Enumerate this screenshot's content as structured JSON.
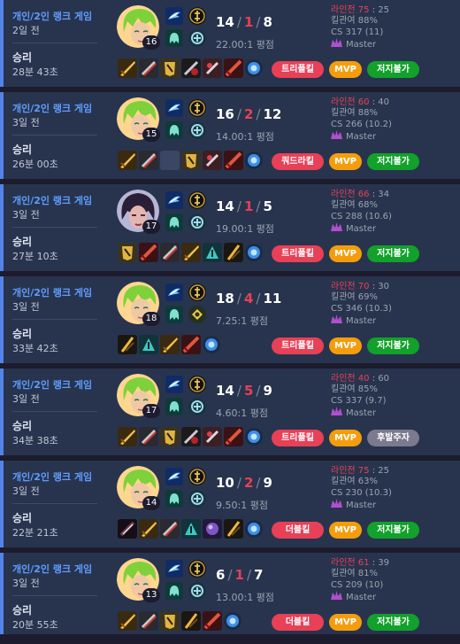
{
  "games": [
    {
      "queue": "개인/2인 랭크 게임",
      "ago": "2일 전",
      "result": "승리",
      "duration": "28분 43초",
      "champion": "green-haired-champion",
      "level": "16",
      "kills": "14",
      "deaths": "1",
      "assists": "8",
      "kda_ratio": "22.00:1 평점",
      "lane_label": "라인전",
      "lane_win": "75",
      "lane_lose": "25",
      "kill_participation": "킬관여 88%",
      "cs": "CS 317 (11)",
      "tier": "Master",
      "badges": [
        "트리플킬",
        "MVP",
        "저지불가"
      ],
      "items": [
        "gold-blade-icon",
        "striped-blade-icon",
        "gold-armor-icon",
        "red-dark-blade-icon",
        "ruby-sword-icon",
        "crimson-blade-icon",
        "blue-ward-icon"
      ]
    },
    {
      "queue": "개인/2인 랭크 게임",
      "ago": "3일 전",
      "result": "승리",
      "duration": "26분 00초",
      "champion": "green-haired-champion",
      "level": "15",
      "kills": "16",
      "deaths": "2",
      "assists": "12",
      "kda_ratio": "14.00:1 평점",
      "lane_label": "라인전",
      "lane_win": "60",
      "lane_lose": "40",
      "kill_participation": "킬관여 88%",
      "cs": "CS 266 (10.2)",
      "tier": "Master",
      "badges": [
        "쿼드라킬",
        "MVP",
        "저지불가"
      ],
      "items": [
        "gold-blade-icon",
        "striped-blade-icon",
        "empty-slot",
        "gold-armor-icon",
        "ruby-sword-icon",
        "crimson-blade-icon",
        "blue-ward-icon"
      ]
    },
    {
      "queue": "개인/2인 랭크 게임",
      "ago": "3일 전",
      "result": "승리",
      "duration": "27분 10초",
      "champion": "dark-haired-champion",
      "level": "17",
      "kills": "14",
      "deaths": "1",
      "assists": "5",
      "kda_ratio": "19.00:1 평점",
      "lane_label": "라인전",
      "lane_win": "66",
      "lane_lose": "34",
      "kill_participation": "킬관여 68%",
      "cs": "CS 288 (10.6)",
      "tier": "Master",
      "badges": [
        "트리플킬",
        "MVP",
        "저지불가"
      ],
      "items": [
        "gold-armor-icon",
        "crimson-blade-icon",
        "striped-blade-icon",
        "gold-blade-icon",
        "teal-blade-icon",
        "gold-dark-blade-icon",
        "blue-ward-icon"
      ]
    },
    {
      "queue": "개인/2인 랭크 게임",
      "ago": "3일 전",
      "result": "승리",
      "duration": "33분 42초",
      "champion": "green-haired-champion",
      "level": "18",
      "kills": "18",
      "deaths": "4",
      "assists": "11",
      "kda_ratio": "7.25:1 평점",
      "lane_label": "라인전",
      "lane_win": "70",
      "lane_lose": "30",
      "kill_participation": "킬관여 69%",
      "cs": "CS 346 (10.3)",
      "tier": "Master",
      "badges": [
        "트리플킬",
        "MVP",
        "저지불가"
      ],
      "items": [
        "gold-dark-blade-icon",
        "teal-blade-icon",
        "gold-blade-icon",
        "crimson-blade-icon",
        "blue-ward-icon"
      ]
    },
    {
      "queue": "개인/2인 랭크 게임",
      "ago": "3일 전",
      "result": "승리",
      "duration": "34분 38초",
      "champion": "green-haired-champion",
      "level": "17",
      "kills": "14",
      "deaths": "5",
      "assists": "9",
      "kda_ratio": "4.60:1 평점",
      "lane_label": "라인전",
      "lane_win": "40",
      "lane_lose": "60",
      "kill_participation": "킬관여 85%",
      "cs": "CS 337 (9.7)",
      "tier": "Master",
      "badges": [
        "트리플킬",
        "MVP",
        "후발주자"
      ],
      "items": [
        "gold-blade-icon",
        "striped-blade-icon",
        "gold-armor-icon",
        "red-dark-blade-icon",
        "ruby-sword-icon",
        "crimson-blade-icon",
        "blue-ward-icon"
      ]
    },
    {
      "queue": "개인/2인 랭크 게임",
      "ago": "3일 전",
      "result": "승리",
      "duration": "22분 21초",
      "champion": "green-haired-champion",
      "level": "14",
      "kills": "10",
      "deaths": "2",
      "assists": "9",
      "kda_ratio": "9.50:1 평점",
      "lane_label": "라인전",
      "lane_win": "75",
      "lane_lose": "25",
      "kill_participation": "킬관여 63%",
      "cs": "CS 230 (10.3)",
      "tier": "Master",
      "badges": [
        "더블킬",
        "MVP",
        "저지불가"
      ],
      "items": [
        "dark-blade-icon",
        "gold-blade-icon",
        "striped-blade-icon",
        "teal-blade-icon",
        "purple-orb-icon",
        "gold-dark-blade-icon",
        "blue-ward-icon"
      ]
    },
    {
      "queue": "개인/2인 랭크 게임",
      "ago": "3일 전",
      "result": "승리",
      "duration": "20분 55초",
      "champion": "green-haired-champion",
      "level": "13",
      "kills": "6",
      "deaths": "1",
      "assists": "7",
      "kda_ratio": "13.00:1 평점",
      "lane_label": "라인전",
      "lane_win": "61",
      "lane_lose": "39",
      "kill_participation": "킬관여 81%",
      "cs": "CS 209 (10)",
      "tier": "Master",
      "badges": [
        "더블킬",
        "MVP",
        "저지불가"
      ],
      "items": [
        "gold-blade-icon",
        "striped-blade-icon",
        "gold-armor-icon",
        "gold-dark-blade-icon",
        "crimson-blade-icon",
        "blue-ward-icon"
      ]
    }
  ]
}
